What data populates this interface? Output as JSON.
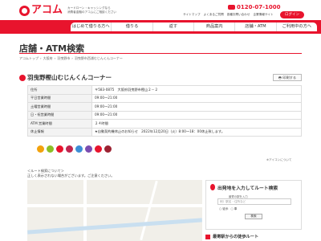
{
  "header": {
    "logo_text": "アコム",
    "tagline_line1": "カードローン・キャッシングなら",
    "tagline_line2": "消費者金融のアコムにご相談ください",
    "phone": "0120-07-1000",
    "util_links": [
      "サイトマップ",
      "よくあるご質問",
      "各種お問い合わせ",
      "企業情報サイト"
    ],
    "login_label": "ログイン",
    "brand_color": "#e8142d"
  },
  "nav": {
    "items": [
      "はじめて借りる方へ",
      "借りる",
      "返す",
      "商品案内",
      "店舗・ATM",
      "ご利用中の方へ"
    ]
  },
  "page": {
    "title": "店舗・ATM検索",
    "breadcrumb": [
      "アコムトップ",
      "›",
      "大阪府",
      "›",
      "羽曳野市",
      "›",
      "羽曳野市西浦むじんくんコーナー"
    ]
  },
  "store": {
    "name": "羽曳野樫山むじんくんコーナー",
    "print_label": "印刷する",
    "rows": [
      {
        "key": "住所",
        "value": "〒583-0875　大阪府羽曳野市樫山２－２"
      },
      {
        "key": "平日営業時間",
        "value": "09:00～21:00"
      },
      {
        "key": "土曜営業時間",
        "value": "09:00～21:00"
      },
      {
        "key": "日・祝営業時間",
        "value": "09:00～21:00"
      },
      {
        "key": "ATM 営業時間",
        "value": "２４時間"
      },
      {
        "key": "休止情報",
        "value": "★自動契約機休止のお知らせ　2022年12月20日（火）8:00～18：00休止致します。"
      }
    ],
    "icon_note": "※アイコンについて",
    "service_icon_colors": [
      "#f2a20c",
      "#8cbf26",
      "#e8142d",
      "#c0264f",
      "#3d8ed6",
      "#7b4cb0",
      "#e8142d",
      "#9c2232"
    ]
  },
  "route_info": {
    "line1": "＜ルート検索について＞",
    "line2": "正しく表示されない場合がございます。ご注意ください。"
  },
  "route": {
    "title": "出発地を入力してルート検索",
    "small": "最寄の駅を入力",
    "placeholder": "例）駅名・住所など",
    "radio1": "徒歩",
    "radio2": "車",
    "button": "検索"
  },
  "walk_route": {
    "label": "最寄駅からの徒歩ルート"
  }
}
